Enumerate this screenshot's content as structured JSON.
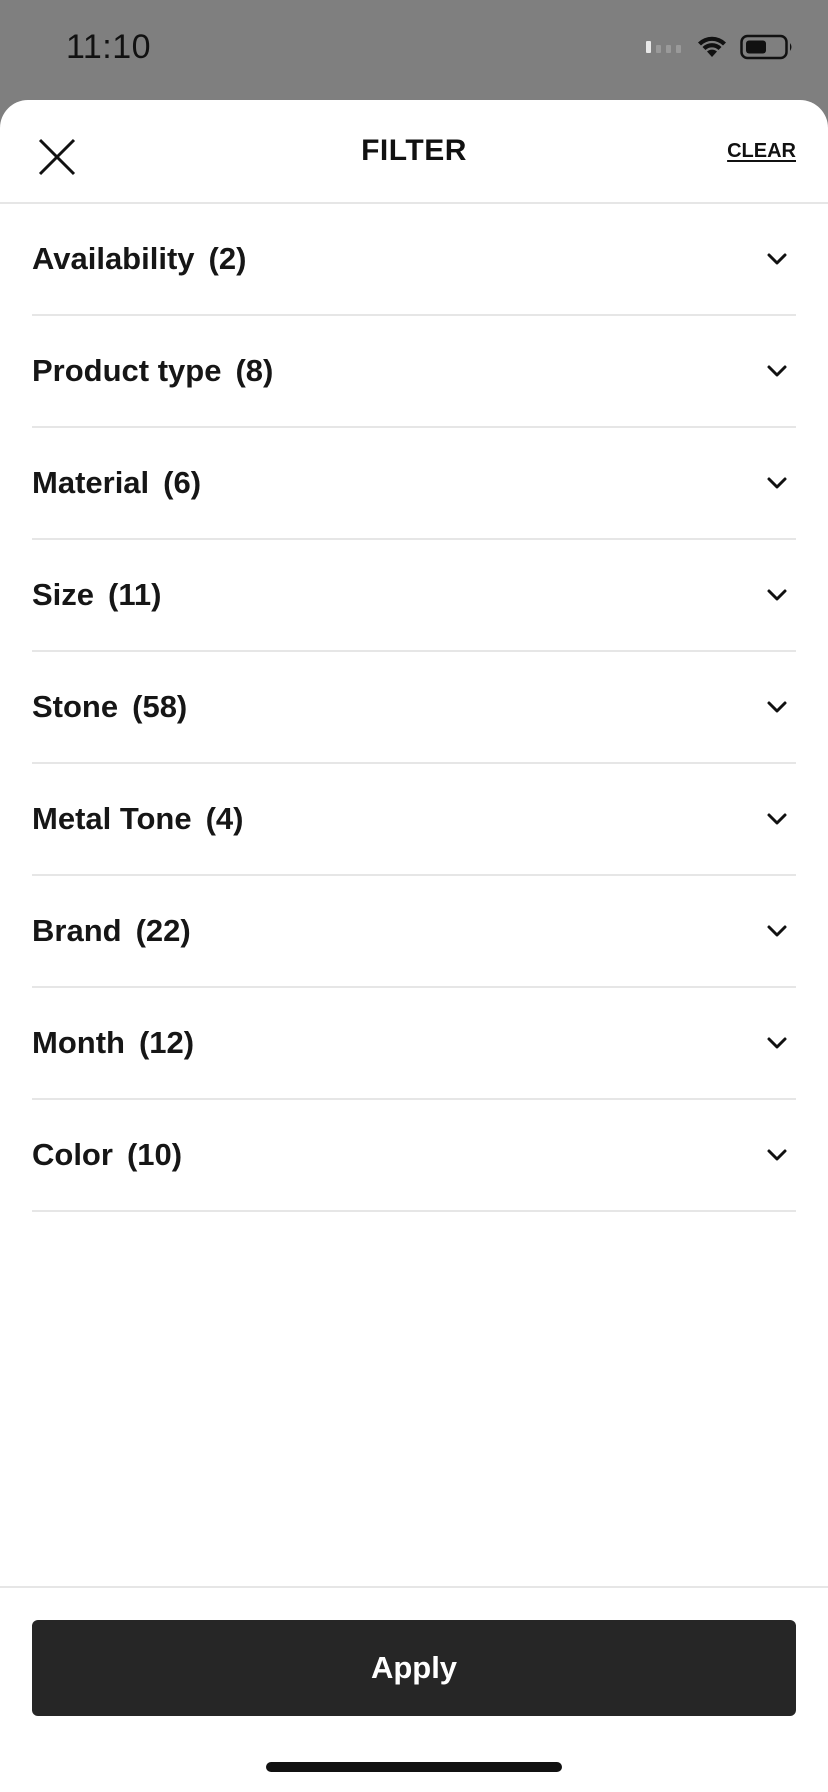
{
  "status_bar": {
    "time": "11:10"
  },
  "header": {
    "title": "FILTER",
    "clear_label": "CLEAR"
  },
  "filters": [
    {
      "label": "Availability",
      "count": "(2)"
    },
    {
      "label": "Product type",
      "count": "(8)"
    },
    {
      "label": "Material",
      "count": "(6)"
    },
    {
      "label": "Size",
      "count": "(11)"
    },
    {
      "label": "Stone",
      "count": "(58)"
    },
    {
      "label": "Metal Tone",
      "count": "(4)"
    },
    {
      "label": "Brand",
      "count": "(22)"
    },
    {
      "label": "Month",
      "count": "(12)"
    },
    {
      "label": "Color",
      "count": "(10)"
    }
  ],
  "footer": {
    "apply_label": "Apply"
  },
  "colors": {
    "overlay": "#7f7f7f",
    "sheet": "#ffffff",
    "divider": "#e6e6e6",
    "apply_button": "#262626",
    "text": "#111111"
  },
  "icons": {
    "close": "close-icon",
    "chevron": "chevron-down-icon",
    "signal": "cellular-signal-icon",
    "wifi": "wifi-icon",
    "battery": "battery-icon"
  }
}
